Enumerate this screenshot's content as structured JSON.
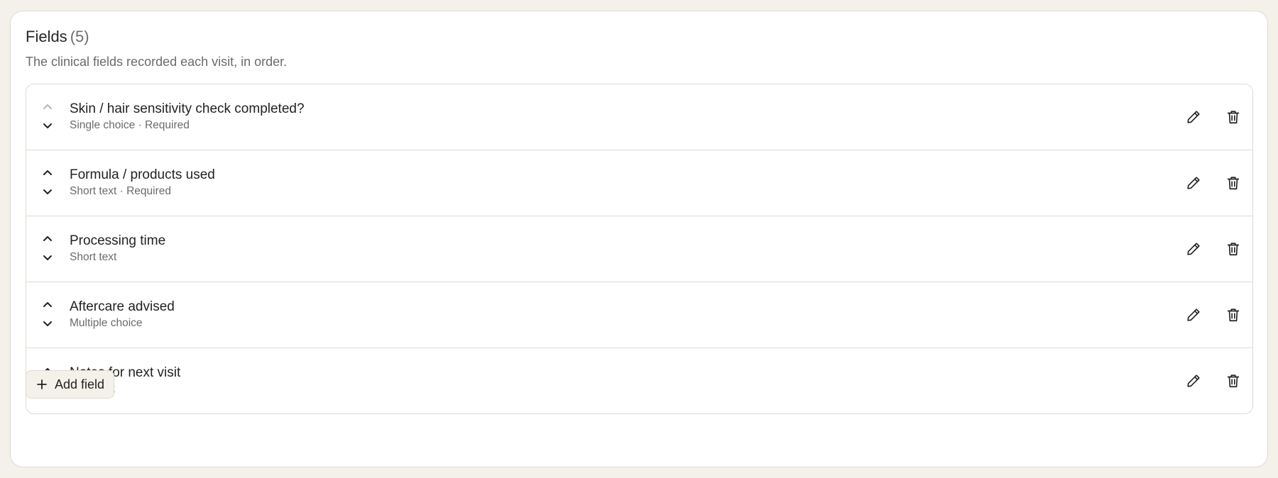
{
  "header": {
    "title": "Fields",
    "count": "(5)",
    "subtitle": "The clinical fields recorded each visit, in order."
  },
  "fields": [
    {
      "label": "Skin / hair sensitivity check completed?",
      "meta": "Single choice · Required",
      "can_move_up": false,
      "can_move_down": true
    },
    {
      "label": "Formula / products used",
      "meta": "Short text · Required",
      "can_move_up": true,
      "can_move_down": true
    },
    {
      "label": "Processing time",
      "meta": "Short text",
      "can_move_up": true,
      "can_move_down": true
    },
    {
      "label": "Aftercare advised",
      "meta": "Multiple choice",
      "can_move_up": true,
      "can_move_down": true
    },
    {
      "label": "Notes for next visit",
      "meta": "Long text",
      "can_move_up": true,
      "can_move_down": false
    }
  ],
  "actions": {
    "add_field_label": "Add field"
  },
  "icons": {
    "move_up": "chevron-up-icon",
    "move_down": "chevron-down-icon",
    "edit": "pencil-icon",
    "delete": "trash-icon",
    "add": "plus-icon"
  },
  "colors": {
    "page_background": "#f3f1ea",
    "card_background": "#ffffff",
    "border": "#dedbd2",
    "text_primary": "#222222",
    "text_secondary": "#6b6b6b",
    "disabled_icon": "#b8b8b8"
  }
}
